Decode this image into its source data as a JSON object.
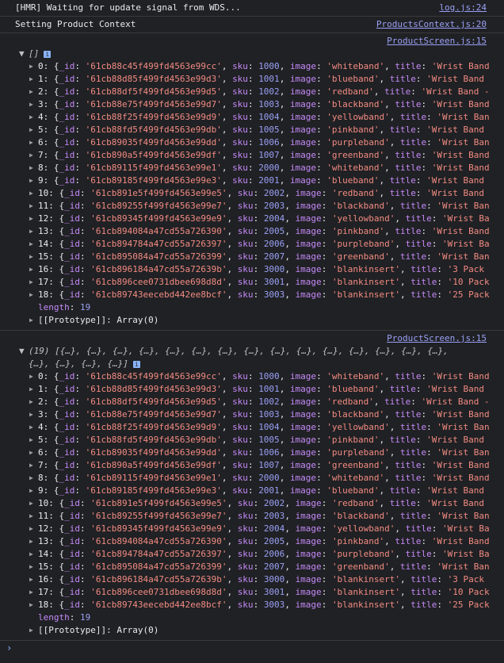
{
  "messages": [
    {
      "text": "[HMR] Waiting for update signal from WDS...",
      "source": "log.js:24"
    },
    {
      "text": "Setting Product Context",
      "source": "ProductsContext.js:20"
    }
  ],
  "groups": [
    {
      "source": "ProductScreen.js:15",
      "header": "[]",
      "info_icon": "i",
      "length_label": "length",
      "length_value": "19",
      "proto_label": "[[Prototype]]",
      "proto_value": "Array(0)"
    },
    {
      "source": "ProductScreen.js:15",
      "header": "(19) [{…}, {…}, {…}, {…}, {…}, {…}, {…}, {…}, {…}, {…}, {…}, {…}, {…}, {…}, {…}, {…}, {…}, {…}, {…}]",
      "info_icon": "i",
      "length_label": "length",
      "length_value": "19",
      "proto_label": "[[Prototype]]",
      "proto_value": "Array(0)"
    }
  ],
  "items": [
    {
      "id": "61cb88c45f499fd4563e99cc",
      "sku": "1000",
      "image": "whiteband",
      "title": "Wrist Band"
    },
    {
      "id": "61cb88d85f499fd4563e99d3",
      "sku": "1001",
      "image": "blueband",
      "title": "Wrist Band"
    },
    {
      "id": "61cb88df5f499fd4563e99d5",
      "sku": "1002",
      "image": "redband",
      "title": "Wrist Band -"
    },
    {
      "id": "61cb88e75f499fd4563e99d7",
      "sku": "1003",
      "image": "blackband",
      "title": "Wrist Band"
    },
    {
      "id": "61cb88f25f499fd4563e99d9",
      "sku": "1004",
      "image": "yellowband",
      "title": "Wrist Ban"
    },
    {
      "id": "61cb88fd5f499fd4563e99db",
      "sku": "1005",
      "image": "pinkband",
      "title": "Wrist Band"
    },
    {
      "id": "61cb89035f499fd4563e99dd",
      "sku": "1006",
      "image": "purpleband",
      "title": "Wrist Ban"
    },
    {
      "id": "61cb890a5f499fd4563e99df",
      "sku": "1007",
      "image": "greenband",
      "title": "Wrist Band"
    },
    {
      "id": "61cb89115f499fd4563e99e1",
      "sku": "2000",
      "image": "whiteband",
      "title": "Wrist Band"
    },
    {
      "id": "61cb89185f499fd4563e99e3",
      "sku": "2001",
      "image": "blueband",
      "title": "Wrist Band"
    },
    {
      "id": "61cb891e5f499fd4563e99e5",
      "sku": "2002",
      "image": "redband",
      "title": "Wrist Band"
    },
    {
      "id": "61cb89255f499fd4563e99e7",
      "sku": "2003",
      "image": "blackband",
      "title": "Wrist Ban"
    },
    {
      "id": "61cb89345f499fd4563e99e9",
      "sku": "2004",
      "image": "yellowband",
      "title": "Wrist Ba"
    },
    {
      "id": "61cb894084a47cd55a726390",
      "sku": "2005",
      "image": "pinkband",
      "title": "Wrist Band"
    },
    {
      "id": "61cb894784a47cd55a726397",
      "sku": "2006",
      "image": "purpleband",
      "title": "Wrist Ba"
    },
    {
      "id": "61cb895084a47cd55a726399",
      "sku": "2007",
      "image": "greenband",
      "title": "Wrist Ban"
    },
    {
      "id": "61cb896184a47cd55a72639b",
      "sku": "3000",
      "image": "blankinsert",
      "title": "3 Pack"
    },
    {
      "id": "61cb896cee0731dbee698d8d",
      "sku": "3001",
      "image": "blankinsert",
      "title": "10 Pack"
    },
    {
      "id": "61cb89743eecebd442ee8bcf",
      "sku": "3003",
      "image": "blankinsert",
      "title": "25 Pack"
    }
  ],
  "labels": {
    "id_key": "_id",
    "sku_key": "sku",
    "image_key": "image",
    "title_key": "title"
  },
  "prompt": "›"
}
